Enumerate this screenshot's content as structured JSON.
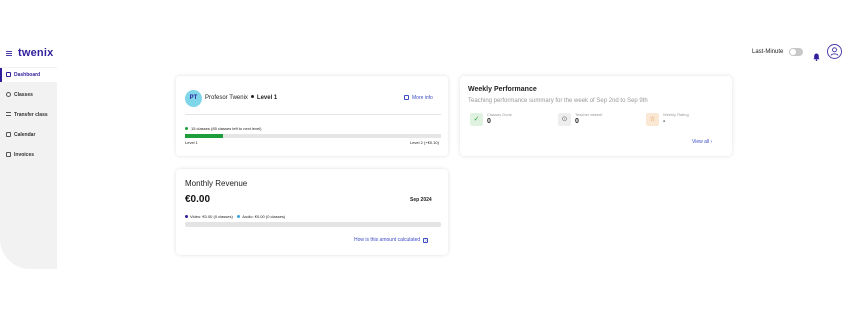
{
  "app": {
    "logo": "twenix"
  },
  "header": {
    "last_minute_label": "Last-Minute",
    "last_minute_on": false
  },
  "sidebar": {
    "items": [
      {
        "label": "Dashboard",
        "icon": "grid-icon",
        "active": true
      },
      {
        "label": "Classes",
        "icon": "search-icon",
        "active": false
      },
      {
        "label": "Transfer class",
        "icon": "transfer-icon",
        "active": false
      },
      {
        "label": "Calendar",
        "icon": "calendar-icon",
        "active": false
      },
      {
        "label": "Invoices",
        "icon": "invoice-icon",
        "active": false
      }
    ]
  },
  "profile_card": {
    "initials": "PT",
    "name": "Profesor Twenix",
    "level": "Level 1",
    "more_info": "More info",
    "progress_note": "15 classes (85 classes left to next level)",
    "progress_fraction": 0.15,
    "level_left": "Level 1",
    "level_right": "Level 2 (+€0.10)"
  },
  "revenue_card": {
    "title": "Monthly Revenue",
    "amount": "€0.00",
    "month": "Sep 2024",
    "video": "Video: €0.00 (0 classes)",
    "audio": "Audio: €0.00 (0 classes)",
    "fill_fraction": 0,
    "how_link": "How is this amount calculated",
    "help_glyph": "?"
  },
  "weekly": {
    "title": "Weekly Performance",
    "subtitle": "Teaching performance summary for the week of Sep 2nd to Sep 9th",
    "stats": [
      {
        "label": "Classes Done",
        "value": "0",
        "icon": "check-icon",
        "glyph": "✓"
      },
      {
        "label": "Teacher absent",
        "value": "0",
        "icon": "clock-icon",
        "glyph": "⊙"
      },
      {
        "label": "Weekly Rating",
        "value": "-",
        "icon": "star-icon",
        "glyph": "☆"
      }
    ],
    "view_all": "View all",
    "view_all_chevron": "›"
  },
  "colors": {
    "brand": "#2f1f9c",
    "link": "#3d4cc4",
    "progress": "#1e9e3a",
    "video_dot": "#2f1f9c",
    "audio_dot": "#3ba3d9",
    "check_bg": "#dff2df",
    "check_fg": "#2e9e3c",
    "clock_bg": "#eeeeee",
    "clock_fg": "#666666",
    "star_bg": "#fbe8d4",
    "star_fg": "#e08a2a"
  }
}
